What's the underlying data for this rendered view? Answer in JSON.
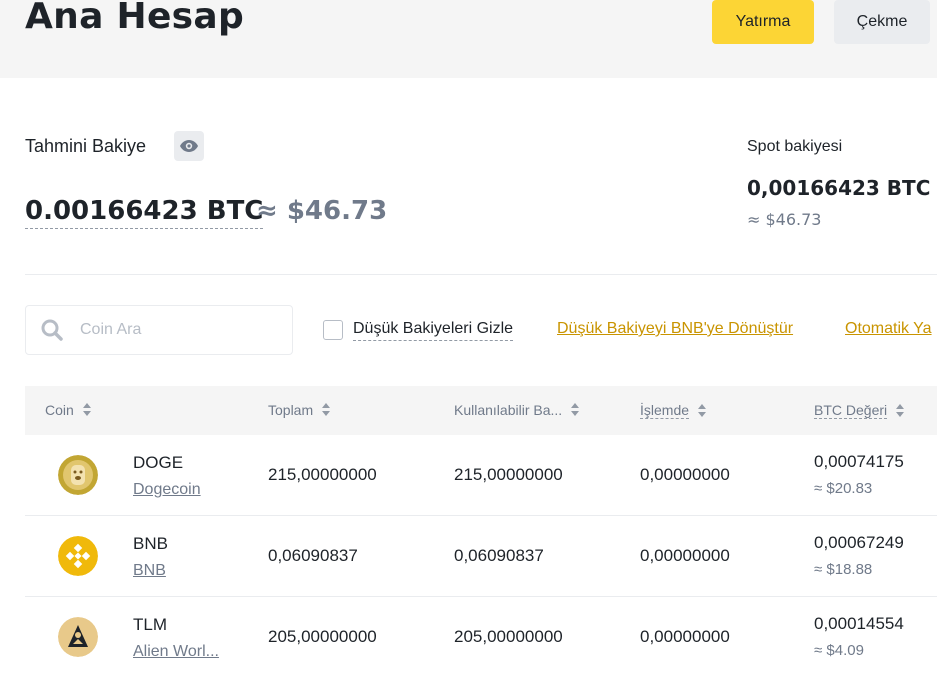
{
  "header": {
    "title": "Ana Hesap",
    "deposit_label": "Yatırma",
    "withdraw_label": "Çekme"
  },
  "balance": {
    "estimated_label": "Tahmini Bakiye",
    "estimated_btc": "0.00166423 BTC",
    "estimated_usd": "≈ $46.73",
    "spot_label": "Spot bakiyesi",
    "spot_btc": "0,00166423 BTC",
    "spot_usd": "≈ $46.73"
  },
  "filters": {
    "search_placeholder": "Coin Ara",
    "hide_small_label": "Düşük Bakiyeleri Gizle",
    "hide_small_checked": false,
    "convert_link": "Düşük Bakiyeyi BNB'ye Dönüştür",
    "auto_link": "Otomatik Ya"
  },
  "table": {
    "headers": {
      "coin": "Coin",
      "total": "Toplam",
      "available": "Kullanılabilir Ba...",
      "in_order": "İşlemde",
      "btc_value": "BTC Değeri"
    },
    "rows": [
      {
        "symbol": "DOGE",
        "name": "Dogecoin",
        "icon": "doge-icon",
        "total": "215,00000000",
        "available": "215,00000000",
        "in_order": "0,00000000",
        "btc": "0,00074175",
        "usd": "≈ $20.83"
      },
      {
        "symbol": "BNB",
        "name": "BNB",
        "icon": "bnb-icon",
        "total": "0,06090837",
        "available": "0,06090837",
        "in_order": "0,00000000",
        "btc": "0,00067249",
        "usd": "≈ $18.88"
      },
      {
        "symbol": "TLM",
        "name": "Alien Worl...",
        "icon": "tlm-icon",
        "total": "205,00000000",
        "available": "205,00000000",
        "in_order": "0,00000000",
        "btc": "0,00014554",
        "usd": "≈ $4.09"
      }
    ]
  },
  "colors": {
    "accent": "#fcd535",
    "link": "#c99400",
    "text": "#1e2329",
    "muted": "#707a8a"
  }
}
